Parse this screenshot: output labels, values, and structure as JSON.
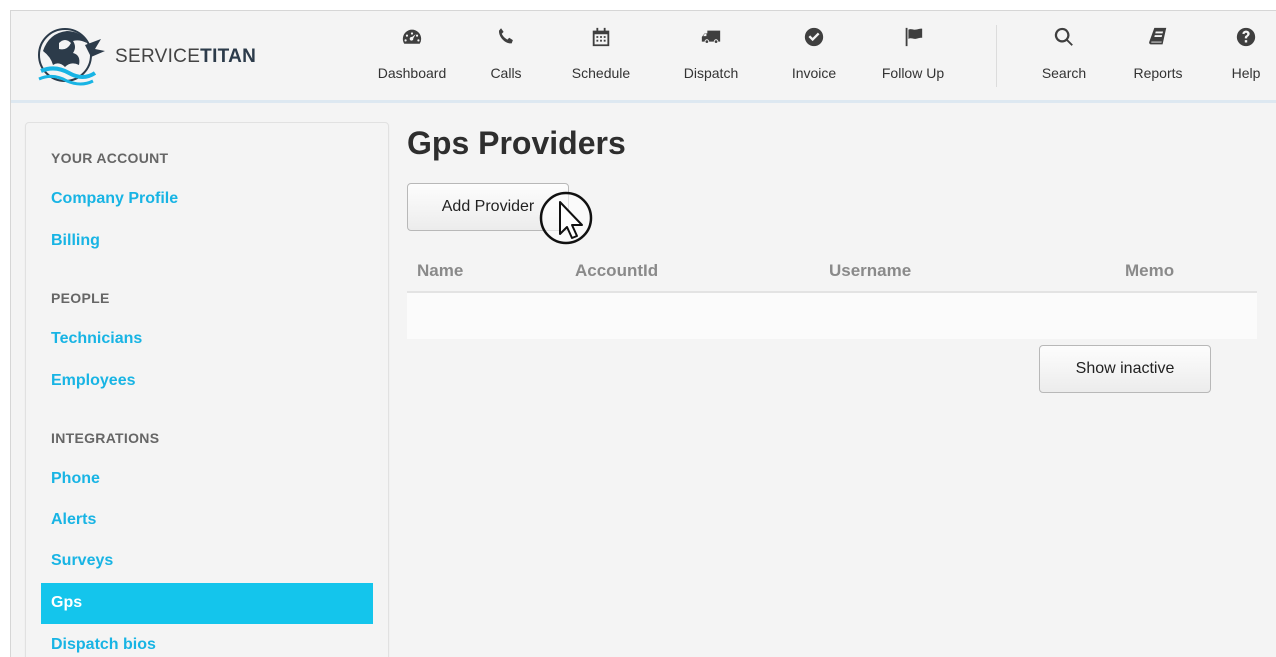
{
  "brand": {
    "name_light": "SERVICE",
    "name_bold": "TITAN",
    "logo_icon": "titan-logo"
  },
  "nav": [
    {
      "label": "Dashboard",
      "icon": "dashboard-gauge-icon"
    },
    {
      "label": "Calls",
      "icon": "phone-icon"
    },
    {
      "label": "Schedule",
      "icon": "calendar-icon"
    },
    {
      "label": "Dispatch",
      "icon": "truck-icon"
    },
    {
      "label": "Invoice",
      "icon": "check-circle-icon"
    },
    {
      "label": "Follow Up",
      "icon": "flag-icon"
    },
    {
      "label": "Search",
      "icon": "search-icon"
    },
    {
      "label": "Reports",
      "icon": "book-icon"
    },
    {
      "label": "Help",
      "icon": "question-circle-icon"
    }
  ],
  "sidebar": {
    "sections": [
      {
        "heading": "YOUR ACCOUNT",
        "items": [
          "Company Profile",
          "Billing"
        ]
      },
      {
        "heading": "PEOPLE",
        "items": [
          "Technicians",
          "Employees"
        ]
      },
      {
        "heading": "INTEGRATIONS",
        "items": [
          "Phone",
          "Alerts",
          "Surveys",
          "Gps",
          "Dispatch bios"
        ]
      }
    ],
    "active_item": "Gps"
  },
  "main": {
    "title": "Gps Providers",
    "add_button": "Add Provider",
    "columns": [
      "Name",
      "AccountId",
      "Username",
      "Memo"
    ],
    "rows": [],
    "show_inactive_button": "Show inactive"
  },
  "colors": {
    "link": "#18b4e4",
    "active_bg": "#14c5ec"
  }
}
